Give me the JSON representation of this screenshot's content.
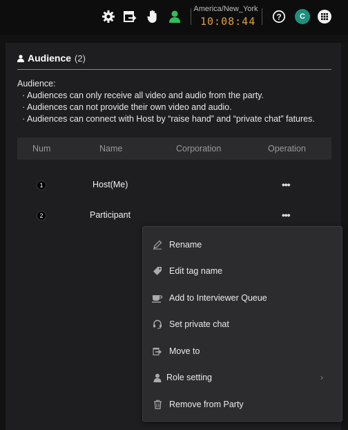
{
  "topbar": {
    "timezone": "America/New_York",
    "clock": "10:08:44",
    "avatar_initial": "C",
    "icons": [
      "gear-icon",
      "move-to-icon",
      "raise-hand-icon",
      "person-icon",
      "help-icon",
      "apps-grid-icon"
    ],
    "colors": {
      "person_icon": "#2fbf5a",
      "avatar": "#1f8f7d",
      "clock": "#e0a03a"
    }
  },
  "audience": {
    "title": "Audience",
    "count": "(2)",
    "description_heading": "Audience:",
    "bullets": [
      "· Audiences can only receive all video and audio from the party.",
      "· Audiences can not provide their own video and audio.",
      "· Audiences can connect with Host by “raise hand” and “private chat” fatures."
    ]
  },
  "table": {
    "headers": [
      "Num",
      "Name",
      "Corporation",
      "Operation"
    ],
    "rows": [
      {
        "num": "1",
        "name": "Host(Me)",
        "corporation": "",
        "operation": "•••"
      },
      {
        "num": "2",
        "name": "Participant",
        "corporation": "",
        "operation": "•••"
      }
    ]
  },
  "context_menu": {
    "items": [
      {
        "label": "Rename",
        "icon": "pen-icon"
      },
      {
        "label": "Edit tag name",
        "icon": "tag-icon"
      },
      {
        "label": "Add to Interviewer Queue",
        "icon": "cup-icon"
      },
      {
        "label": "Set private chat",
        "icon": "headset-icon"
      },
      {
        "label": "Move to",
        "icon": "move-to-icon"
      },
      {
        "label": "Role setting",
        "icon": "person-icon",
        "submenu": "›"
      },
      {
        "label": "Remove from Party",
        "icon": "trash-icon"
      }
    ]
  }
}
